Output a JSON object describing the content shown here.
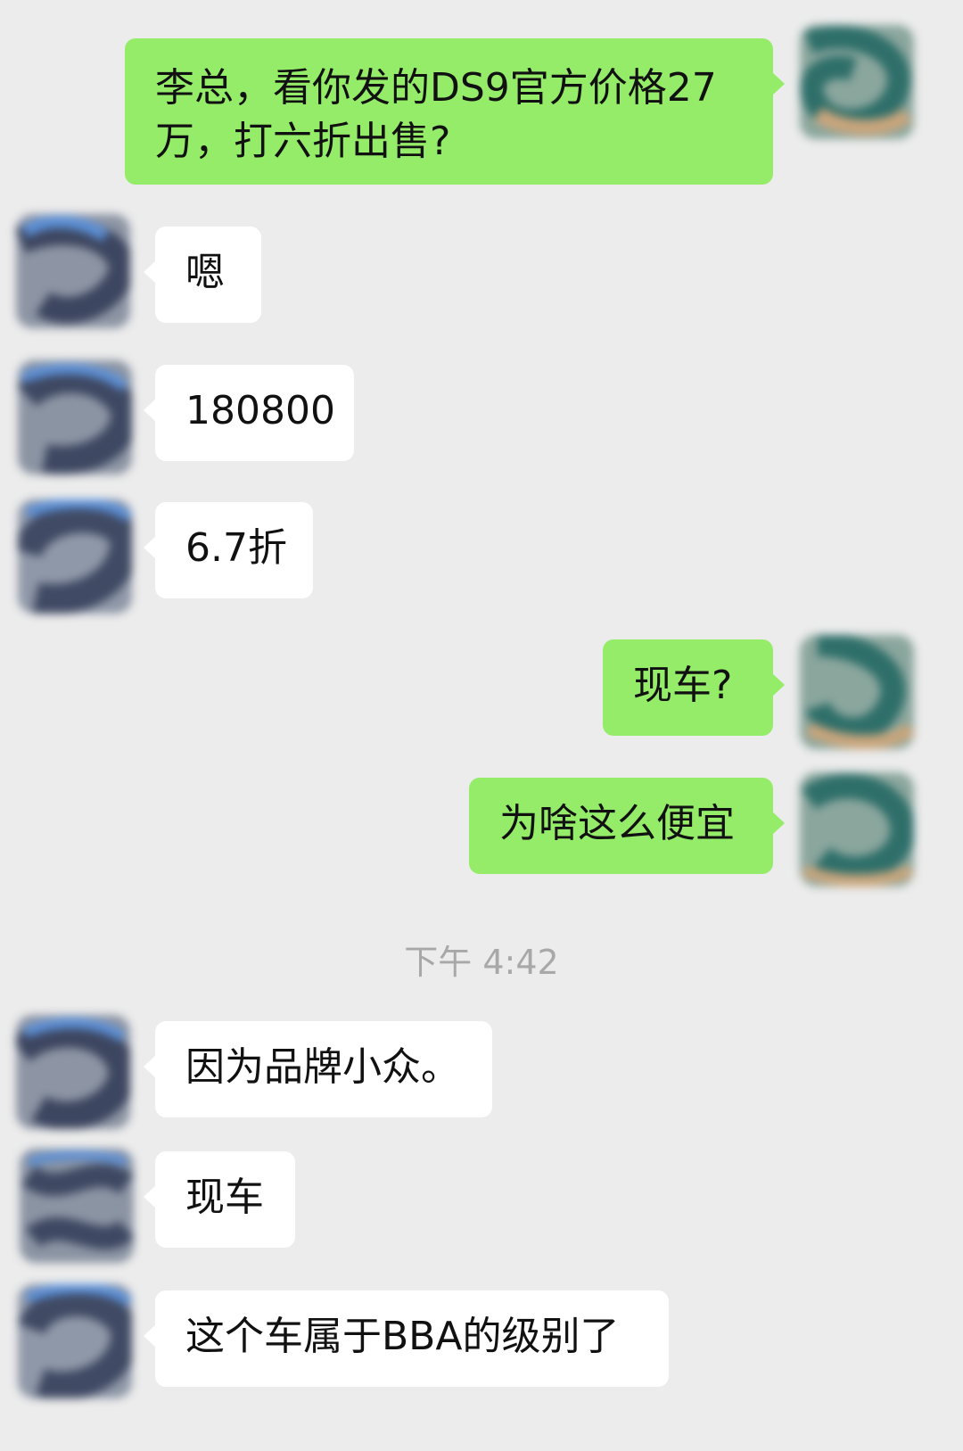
{
  "colors": {
    "background": "#ececec",
    "outgoing_bubble": "#95ec69",
    "incoming_bubble": "#ffffff",
    "timestamp_text": "#a8a8a8"
  },
  "messages": [
    {
      "side": "out",
      "text": "李总，看你发的DS9官方价格27万，打六折出售?"
    },
    {
      "side": "in",
      "text": "嗯"
    },
    {
      "side": "in",
      "text": "180800"
    },
    {
      "side": "in",
      "text": "6.7折"
    },
    {
      "side": "out",
      "text": "现车?"
    },
    {
      "side": "out",
      "text": "为啥这么便宜"
    },
    {
      "side": "in",
      "text": "因为品牌小众。"
    },
    {
      "side": "in",
      "text": "现车"
    },
    {
      "side": "in",
      "text": "这个车属于BBA的级别了"
    }
  ],
  "timestamp": "下午 4:42"
}
